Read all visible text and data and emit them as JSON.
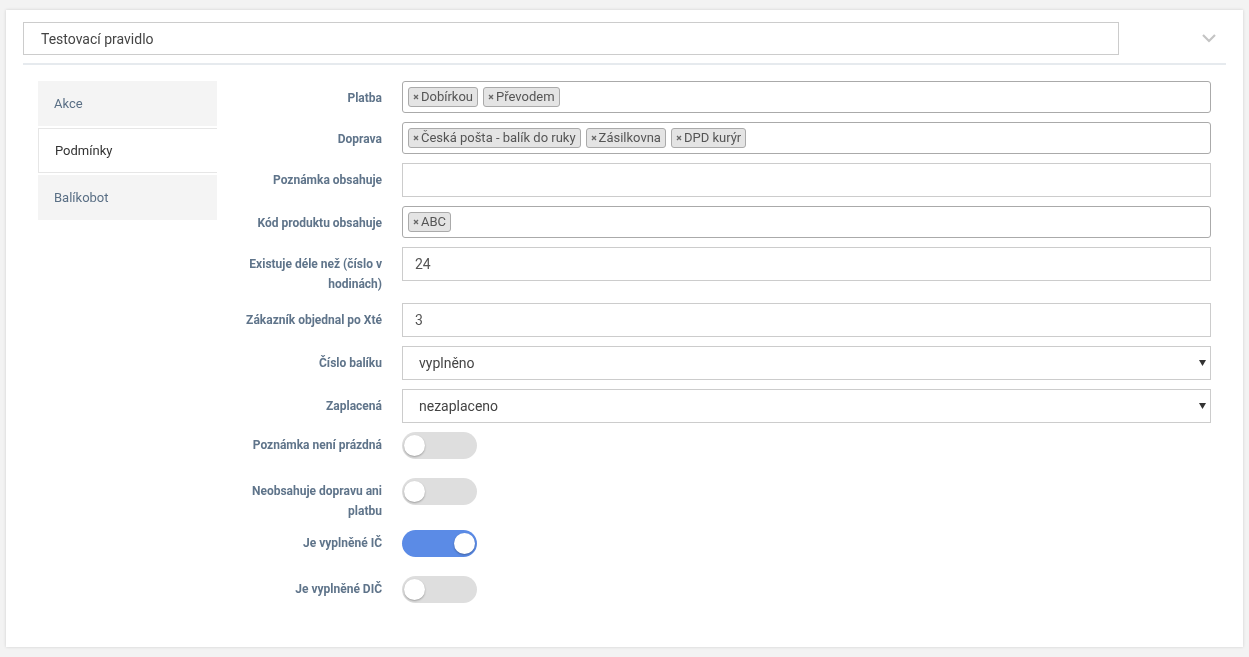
{
  "rule_name": {
    "value": "Testovací pravidlo"
  },
  "tabs": [
    {
      "label": "Akce",
      "selected": false
    },
    {
      "label": "Podmínky",
      "selected": true
    },
    {
      "label": "Balíkobot",
      "selected": false
    }
  ],
  "fields": [
    {
      "kind": "tags",
      "label": "Platba",
      "tags": [
        "Dobírkou",
        "Převodem"
      ]
    },
    {
      "kind": "tags",
      "label": "Doprava",
      "tags": [
        "Česká pošta - balík do ruky",
        "Zásilkovna",
        "DPD kurýr"
      ]
    },
    {
      "kind": "text",
      "label": "Poznámka obsahuje"
    },
    {
      "kind": "tags",
      "label": "Kód produktu obsahuje",
      "tags": [
        "ABC"
      ]
    },
    {
      "kind": "text",
      "label": "Existuje déle než (číslo v hodinách)",
      "value": "24"
    },
    {
      "kind": "text",
      "label": "Zákazník objednal po Xté",
      "value": "3"
    },
    {
      "kind": "select",
      "label": "Číslo balíku",
      "value": "vyplněno"
    },
    {
      "kind": "select",
      "label": "Zaplacená",
      "value": "nezaplaceno"
    },
    {
      "kind": "toggle",
      "label": "Poznámka není prázdná",
      "on": false
    },
    {
      "kind": "toggle",
      "label": "Neobsahuje dopravu ani platbu",
      "on": false
    },
    {
      "kind": "toggle",
      "label": "Je vyplněné IČ",
      "on": true
    },
    {
      "kind": "toggle",
      "label": "Je vyplněné DIČ",
      "on": false
    }
  ]
}
